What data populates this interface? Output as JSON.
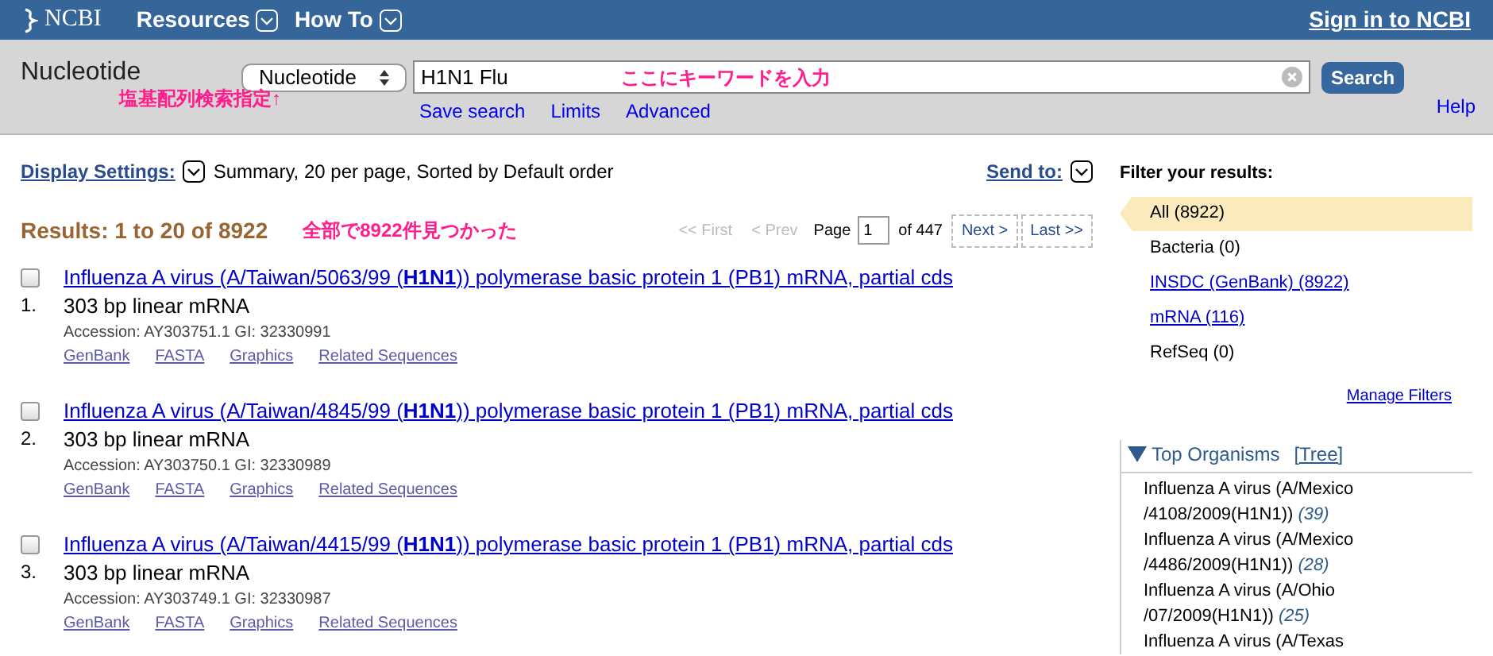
{
  "topbar": {
    "logo": "NCBI",
    "menus": [
      {
        "label": "Resources"
      },
      {
        "label": "How To"
      }
    ],
    "sign_in": "Sign in to NCBI"
  },
  "search": {
    "title": "Nucleotide",
    "database": "Nucleotide",
    "query": "H1N1 Flu",
    "query_note": "ここにキーワードを入力",
    "db_note": "塩基配列検索指定↑",
    "button": "Search",
    "links": [
      "Save search",
      "Limits",
      "Advanced"
    ],
    "help": "Help"
  },
  "display": {
    "label": "Display Settings:",
    "summary": "Summary, 20 per page, Sorted by Default order",
    "send_to": "Send to:"
  },
  "results": {
    "heading": "Results: 1 to 20 of 8922",
    "note": "全部で8922件見つかった",
    "pager": {
      "first": "<< First",
      "prev": "< Prev",
      "page_label": "Page",
      "page": "1",
      "of": "of 447",
      "next": "Next >",
      "last": "Last >>"
    },
    "items": [
      {
        "number": "1.",
        "checked": false,
        "title": "Influenza A virus (A/Taiwan/5063/99 (**H1N1**)) polymerase basic protein 1 (PB1) mRNA, partial cds",
        "desc": "303 bp linear mRNA",
        "accession": "Accession: AY303751.1 GI: 32330991",
        "links": [
          "GenBank",
          "FASTA",
          "Graphics",
          "Related Sequences"
        ]
      },
      {
        "number": "2.",
        "checked": false,
        "title": "Influenza A virus (A/Taiwan/4845/99 (**H1N1**)) polymerase basic protein 1 (PB1) mRNA, partial cds",
        "desc": "303 bp linear mRNA",
        "accession": "Accession: AY303750.1 GI: 32330989",
        "links": [
          "GenBank",
          "FASTA",
          "Graphics",
          "Related Sequences"
        ]
      },
      {
        "number": "3.",
        "checked": false,
        "title": "Influenza A virus (A/Taiwan/4415/99 (**H1N1**)) polymerase basic protein 1 (PB1) mRNA, partial cds",
        "desc": "303 bp linear mRNA",
        "accession": "Accession: AY303749.1 GI: 32330987",
        "links": [
          "GenBank",
          "FASTA",
          "Graphics",
          "Related Sequences"
        ]
      }
    ]
  },
  "filters": {
    "heading": "Filter your results:",
    "items": [
      {
        "label": "All (8922)",
        "selected": true,
        "kind": "text"
      },
      {
        "label": "Bacteria (0)",
        "selected": false,
        "kind": "text"
      },
      {
        "label": "INSDC (GenBank) (8922)",
        "selected": false,
        "kind": "link"
      },
      {
        "label": "mRNA (116)",
        "selected": false,
        "kind": "link"
      },
      {
        "label": "RefSeq (0)",
        "selected": false,
        "kind": "text"
      }
    ],
    "manage": "Manage Filters"
  },
  "organisms": {
    "heading": "Top Organisms",
    "tree": "[Tree]",
    "expanded": true,
    "items": [
      {
        "name": "Influenza A virus (A/Mexico /4108/2009(H1N1))",
        "count": "(39)"
      },
      {
        "name": "Influenza A virus (A/Mexico /4486/2009(H1N1))",
        "count": "(28)"
      },
      {
        "name": "Influenza A virus (A/Ohio /07/2009(H1N1))",
        "count": "(25)"
      },
      {
        "name": "Influenza A virus (A/Texas"
      }
    ]
  }
}
